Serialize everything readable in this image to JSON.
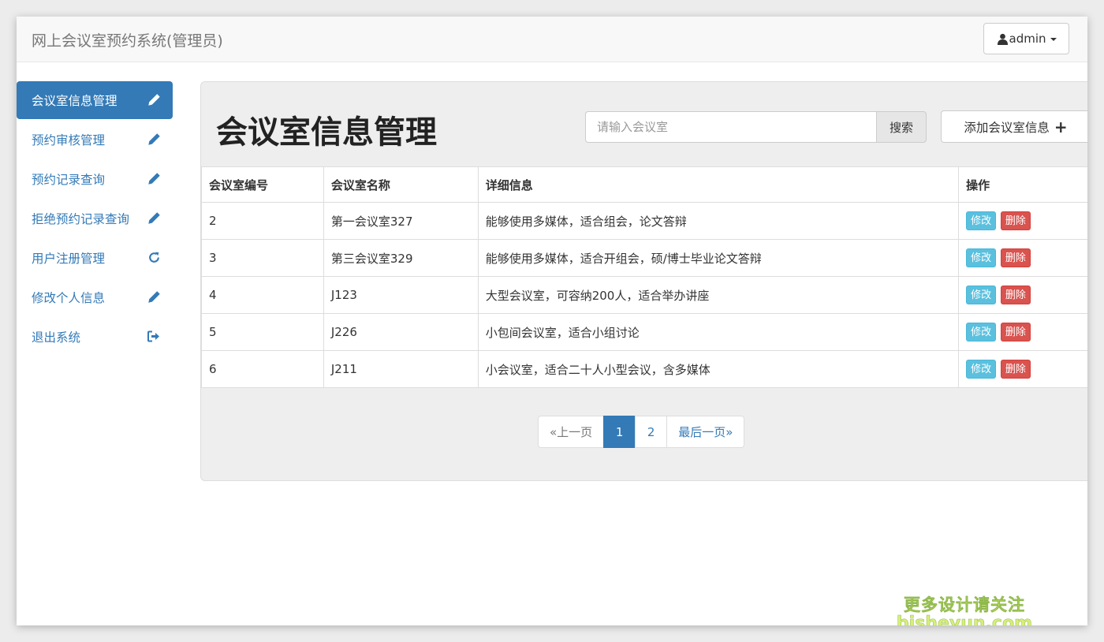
{
  "navbar": {
    "brand": "网上会议室预约系统(管理员)",
    "user_label": "admin"
  },
  "sidebar": {
    "items": [
      {
        "label": "会议室信息管理",
        "icon": "pencil-icon",
        "active": true
      },
      {
        "label": "预约审核管理",
        "icon": "pencil-icon"
      },
      {
        "label": "预约记录查询",
        "icon": "pencil-icon"
      },
      {
        "label": "拒绝预约记录查询",
        "icon": "pencil-icon"
      },
      {
        "label": "用户注册管理",
        "icon": "refresh-icon"
      },
      {
        "label": "修改个人信息",
        "icon": "pencil-icon"
      },
      {
        "label": "退出系统",
        "icon": "logout-icon"
      }
    ]
  },
  "main": {
    "title": "会议室信息管理",
    "search_placeholder": "请输入会议室",
    "search_button": "搜索",
    "add_button": "添加会议室信息",
    "table": {
      "headers": [
        "会议室编号",
        "会议室名称",
        "详细信息",
        "操作"
      ],
      "rows": [
        {
          "id": "2",
          "name": "第一会议室327",
          "detail": "能够使用多媒体，适合组会，论文答辩"
        },
        {
          "id": "3",
          "name": "第三会议室329",
          "detail": "能够使用多媒体，适合开组会，硕/博士毕业论文答辩"
        },
        {
          "id": "4",
          "name": "J123",
          "detail": "大型会议室，可容纳200人，适合举办讲座"
        },
        {
          "id": "5",
          "name": "J226",
          "detail": "小包间会议室，适合小组讨论"
        },
        {
          "id": "6",
          "name": "J211",
          "detail": "小会议室，适合二十人小型会议，含多媒体"
        }
      ],
      "edit_label": "修改",
      "delete_label": "删除"
    },
    "pagination": {
      "prev": "«上一页",
      "pages": [
        "1",
        "2"
      ],
      "current": "1",
      "last": "最后一页»"
    }
  },
  "watermark": {
    "line1": "更多设计请关注",
    "line2": "bisheyun.com"
  },
  "colors": {
    "primary": "#337ab7",
    "info": "#5bc0de",
    "danger": "#d9534f",
    "panel_bg": "#eeeeee",
    "navbar_bg": "#f8f8f8"
  }
}
